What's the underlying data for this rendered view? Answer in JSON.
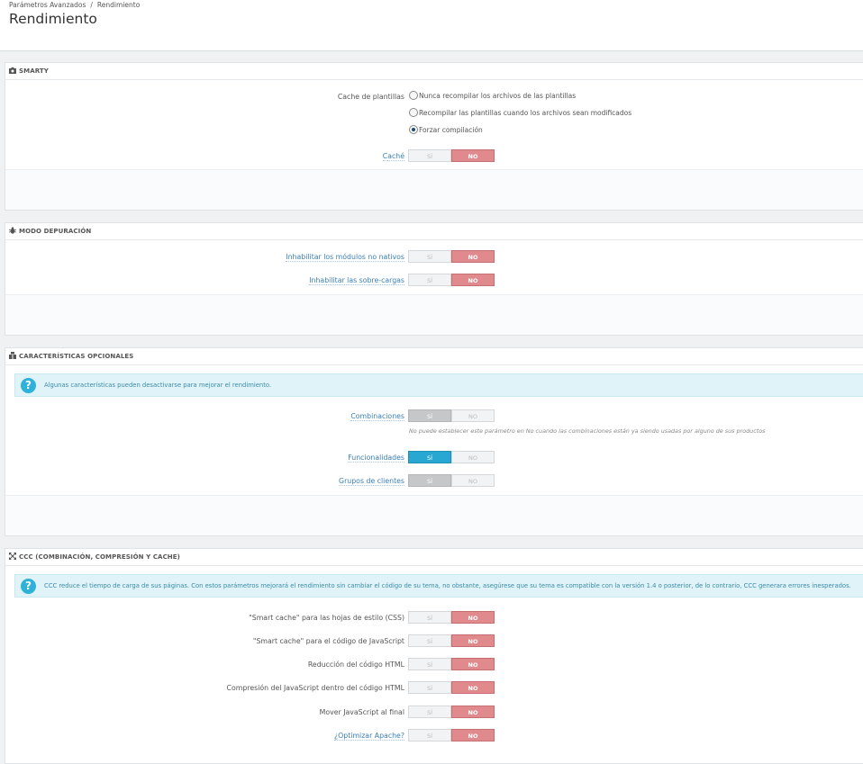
{
  "breadcrumb": {
    "item1": "Parámetros Avanzados",
    "separator": "/",
    "item2": "Rendimiento"
  },
  "page_title": "Rendimiento",
  "toggle": {
    "yes": "SÍ",
    "no": "NO"
  },
  "smarty": {
    "heading": "SMARTY",
    "template_cache_label": "Cache de plantillas",
    "options": [
      "Nunca recompilar los archivos de las plantillas",
      "Recompilar las plantillas cuando los archivos sean modificados",
      "Forzar compilación"
    ],
    "selected_option": "Forzar compilación",
    "cache_label": "Caché",
    "cache_value": "NO"
  },
  "debug": {
    "heading": "MODO DEPURACIÓN",
    "disable_non_native_label": "Inhabilitar los módulos no nativos",
    "disable_non_native_value": "NO",
    "disable_overrides_label": "Inhabilitar las sobre-cargas",
    "disable_overrides_value": "NO"
  },
  "optional": {
    "heading": "CARACTERÍSTICAS OPCIONALES",
    "info": "Algunas características pueden desactivarse para mejorar el rendimiento.",
    "combinations_label": "Combinaciones",
    "combinations_value": "SÍ",
    "combinations_help": "No puede establecer este parámetro en No cuando las combinaciones están ya siendo usadas por alguno de sus productos",
    "features_label": "Funcionalidades",
    "features_value": "SÍ",
    "customer_groups_label": "Grupos de clientes",
    "customer_groups_value": "SÍ"
  },
  "ccc": {
    "heading": "CCC (COMBINACIÓN, COMPRESIÓN Y CACHE)",
    "info": "CCC reduce el tiempo de carga de sus páginas. Con estos parámetros mejorará el rendimiento sin cambiar el código de su tema, no obstante, asegúrese que su tema es compatible con la versión 1.4 o posterior, de lo contrario, CCC generara errores inesperados.",
    "rows": [
      {
        "label": "\"Smart cache\" para las hojas de estilo (CSS)",
        "value": "NO",
        "tip": false
      },
      {
        "label": "\"Smart cache\" para el código de JavaScript",
        "value": "NO",
        "tip": false
      },
      {
        "label": "Reducción del código HTML",
        "value": "NO",
        "tip": false
      },
      {
        "label": "Compresión del JavaScript dentro del código HTML",
        "value": "NO",
        "tip": false
      },
      {
        "label": "Mover JavaScript al final",
        "value": "NO",
        "tip": false
      },
      {
        "label": "¿Optimizar Apache?",
        "value": "NO",
        "tip": true
      }
    ]
  },
  "colors": {
    "no_active": "#e08a8e",
    "yes_active": "#27a7d1",
    "info_bg": "#dff3f8"
  }
}
